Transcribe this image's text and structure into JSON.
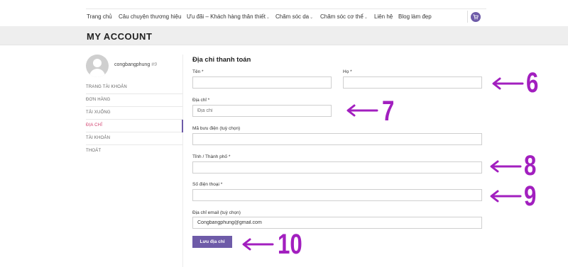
{
  "nav": {
    "items": [
      {
        "label": "Trang chủ",
        "dropdown": false
      },
      {
        "label": "Câu chuyện thương hiệu",
        "dropdown": false
      },
      {
        "label": "Ưu đãi – Khách hàng thân thiết",
        "dropdown": true
      },
      {
        "label": "Chăm sóc da",
        "dropdown": true
      },
      {
        "label": "Chăm sóc cơ thể",
        "dropdown": true
      },
      {
        "label": "Liên hệ",
        "dropdown": false
      },
      {
        "label": "Blog làm đẹp",
        "dropdown": false
      }
    ],
    "cart_icon": "cart-icon"
  },
  "page": {
    "title": "MY ACCOUNT"
  },
  "account": {
    "username": "congbangphung",
    "user_id": "#9",
    "menu": [
      {
        "label": "TRANG TÀI KHOẢN",
        "active": false
      },
      {
        "label": "ĐƠN HÀNG",
        "active": false
      },
      {
        "label": "TẢI XUỐNG",
        "active": false
      },
      {
        "label": "ĐỊA CHỈ",
        "active": true
      },
      {
        "label": "TÀI KHOẢN",
        "active": false
      },
      {
        "label": "THOÁT",
        "active": false
      }
    ]
  },
  "form": {
    "title": "Địa chỉ thanh toán",
    "first_name": {
      "label": "Tên *",
      "value": ""
    },
    "last_name": {
      "label": "Họ *",
      "value": ""
    },
    "address": {
      "label": "Địa chỉ *",
      "placeholder": "Địa chỉ"
    },
    "postcode": {
      "label": "Mã bưu điện (tuỳ chọn)",
      "value": ""
    },
    "city": {
      "label": "Tỉnh / Thành phố *",
      "value": ""
    },
    "phone": {
      "label": "Số điện thoại *",
      "value": ""
    },
    "email": {
      "label": "Địa chỉ email (tuỳ chọn)",
      "value": "Congbangphung@gmail.com"
    },
    "save_label": "Lưu địa chỉ"
  },
  "annotations": {
    "color": "#a21fbf",
    "steps": [
      "6",
      "7",
      "8",
      "9",
      "10"
    ]
  },
  "colors": {
    "accent": "#6e5ba8",
    "active_link": "#d13b6a"
  }
}
